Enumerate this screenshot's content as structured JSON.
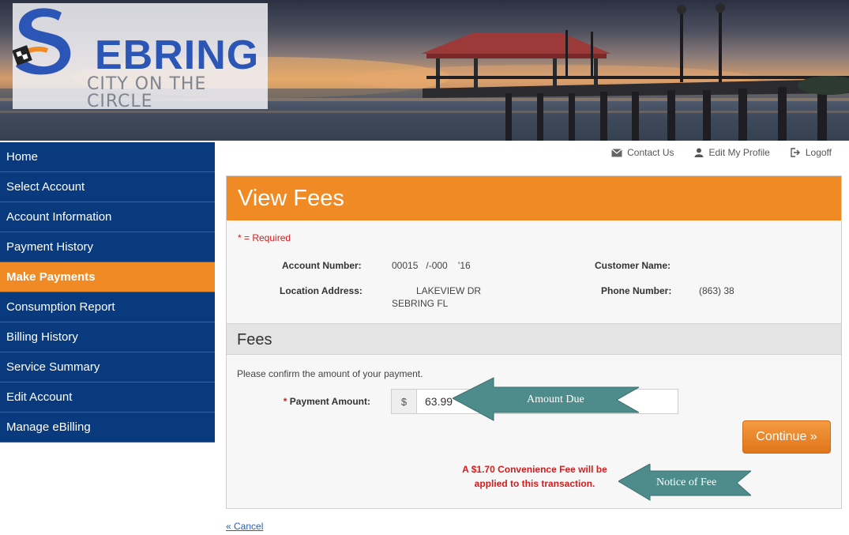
{
  "logo": {
    "name": "EBRING",
    "tagline": "CITY ON THE CIRCLE"
  },
  "sidebar": {
    "items": [
      {
        "label": "Home"
      },
      {
        "label": "Select Account"
      },
      {
        "label": "Account Information"
      },
      {
        "label": "Payment History"
      },
      {
        "label": "Make Payments",
        "active": true
      },
      {
        "label": "Consumption Report"
      },
      {
        "label": "Billing History"
      },
      {
        "label": "Service Summary"
      },
      {
        "label": "Edit Account"
      },
      {
        "label": "Manage eBilling"
      }
    ]
  },
  "toplinks": {
    "contact": "Contact Us",
    "profile": "Edit My Profile",
    "logoff": "Logoff"
  },
  "panel": {
    "title": "View Fees",
    "required_note": "* = Required",
    "account": {
      "account_number_label": "Account Number:",
      "account_number_value": "00015   /-000    '16",
      "location_label": "Location Address:",
      "location_line1": "LAKEVIEW DR",
      "location_line2": "SEBRING FL",
      "customer_label": "Customer Name:",
      "phone_label": "Phone Number:",
      "phone_value": "(863) 38"
    },
    "fees": {
      "heading": "Fees",
      "confirm_text": "Please confirm the amount of your payment.",
      "payment_label": "Payment Amount:",
      "required_star": "*",
      "currency": "$",
      "payment_amount": "63.99",
      "continue_label": "Continue »",
      "fee_notice_line1": "A $1.70 Convenience Fee will be",
      "fee_notice_line2": "applied to this transaction."
    }
  },
  "callouts": {
    "amount_due": "Amount Due",
    "notice_of_fee": "Notice of Fee",
    "color": "#4e8c8c"
  },
  "cancel_label": "« Cancel",
  "colors": {
    "nav_blue": "#0a3a7e",
    "accent_orange": "#f08a24",
    "required_red": "#d41d1d"
  }
}
